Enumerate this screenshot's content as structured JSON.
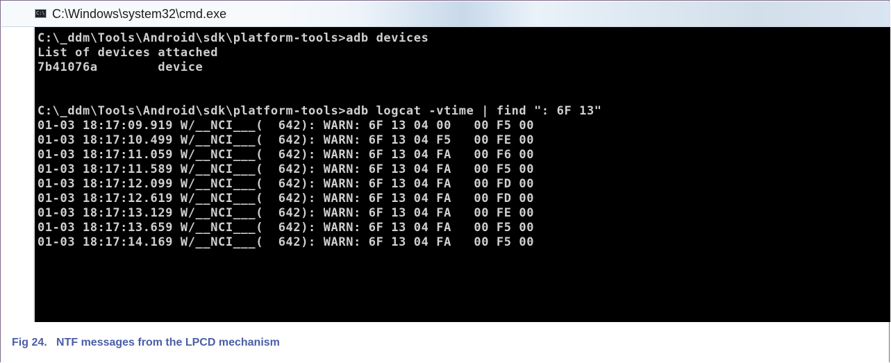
{
  "window": {
    "title": "C:\\Windows\\system32\\cmd.exe",
    "icon": "cmd-icon",
    "icon_glyph": "C:\\"
  },
  "console": {
    "lines": [
      "C:\\_ddm\\Tools\\Android\\sdk\\platform-tools>adb devices",
      "List of devices attached",
      "7b41076a        device",
      "",
      "",
      "C:\\_ddm\\Tools\\Android\\sdk\\platform-tools>adb logcat -vtime | find \": 6F 13\"",
      "01-03 18:17:09.919 W/__NCI___(  642): WARN: 6F 13 04 00   00 F5 00",
      "01-03 18:17:10.499 W/__NCI___(  642): WARN: 6F 13 04 F5   00 FE 00",
      "01-03 18:17:11.059 W/__NCI___(  642): WARN: 6F 13 04 FA   00 F6 00",
      "01-03 18:17:11.589 W/__NCI___(  642): WARN: 6F 13 04 FA   00 F5 00",
      "01-03 18:17:12.099 W/__NCI___(  642): WARN: 6F 13 04 FA   00 FD 00",
      "01-03 18:17:12.619 W/__NCI___(  642): WARN: 6F 13 04 FA   00 FD 00",
      "01-03 18:17:13.129 W/__NCI___(  642): WARN: 6F 13 04 FA   00 FE 00",
      "01-03 18:17:13.659 W/__NCI___(  642): WARN: 6F 13 04 FA   00 F5 00",
      "01-03 18:17:14.169 W/__NCI___(  642): WARN: 6F 13 04 FA   00 F5 00"
    ]
  },
  "caption": {
    "text": "Fig 24.   NTF messages from the LPCD mechanism"
  }
}
